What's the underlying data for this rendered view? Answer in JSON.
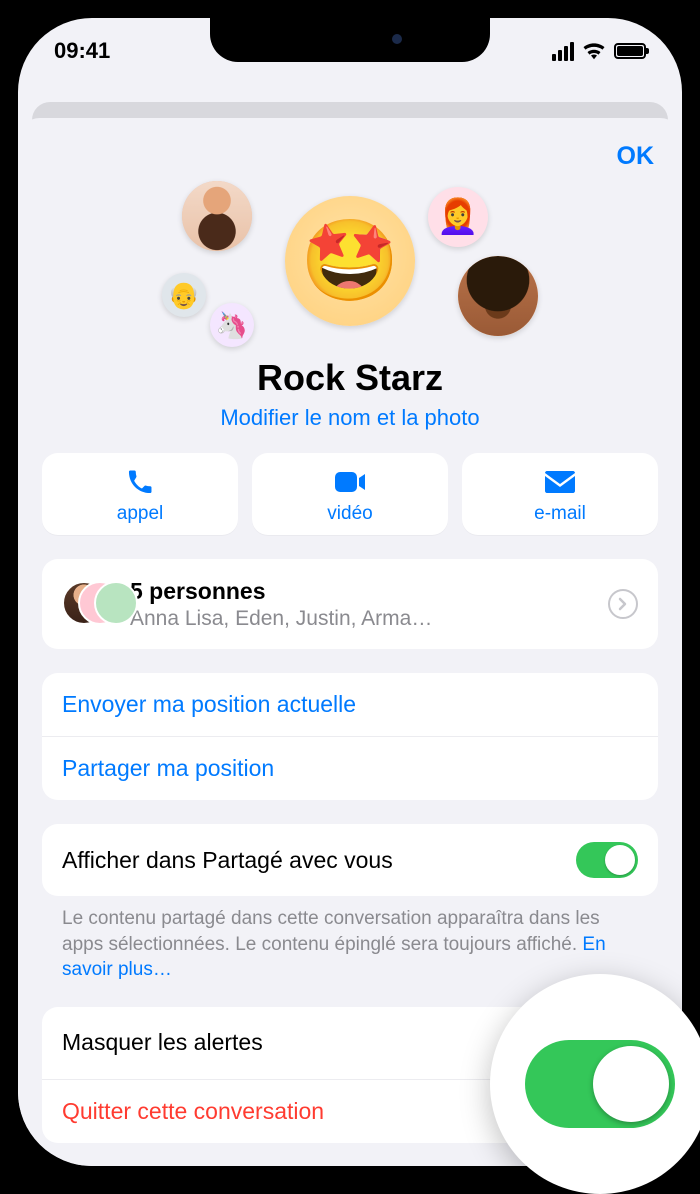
{
  "statusbar": {
    "time": "09:41"
  },
  "sheet": {
    "done_label": "OK",
    "group_name": "Rock Starz",
    "edit_label": "Modifier le nom et la photo"
  },
  "actions": {
    "call": "appel",
    "video": "vidéo",
    "email": "e-mail"
  },
  "members": {
    "count_label": "5 personnes",
    "names_preview": "Anna Lisa, Eden, Justin, Arma…"
  },
  "location": {
    "send_current": "Envoyer ma position actuelle",
    "share": "Partager ma position"
  },
  "shared": {
    "toggle_label": "Afficher dans Partagé avec vous",
    "footnote_text": "Le contenu partagé dans cette conversation apparaîtra dans les apps sélectionnées. Le contenu épinglé sera toujours affiché. ",
    "learn_more": "En savoir plus…",
    "enabled": true
  },
  "alerts": {
    "label": "Masquer les alertes",
    "enabled": true
  },
  "leave": {
    "label": "Quitter cette conversation"
  }
}
